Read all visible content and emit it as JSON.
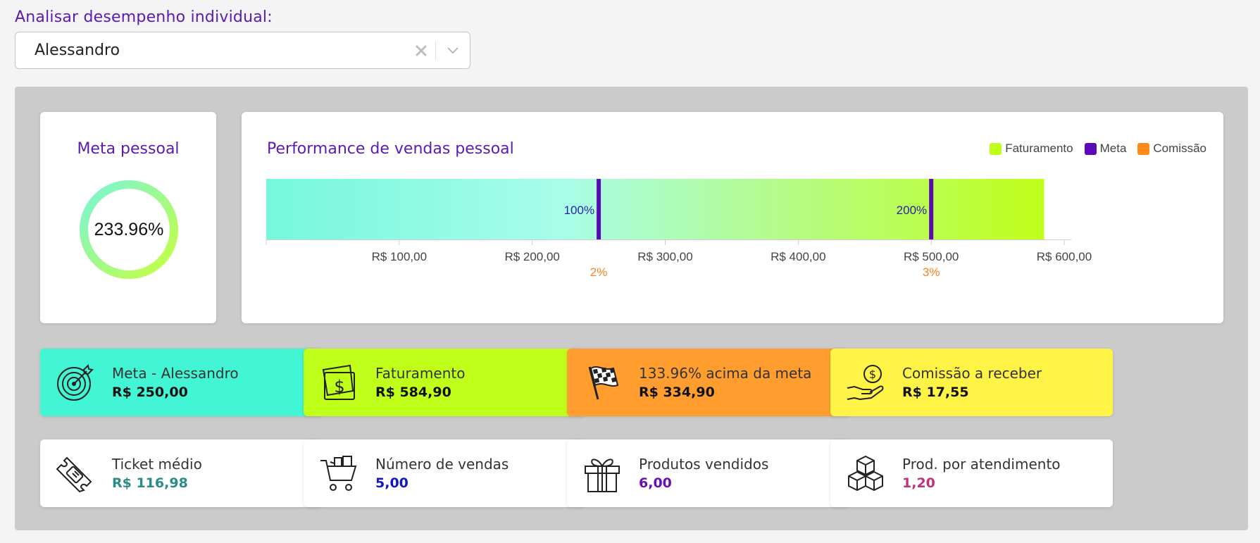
{
  "selector": {
    "label": "Analisar desempenho individual:",
    "value": "Alessandro"
  },
  "meta_card": {
    "title": "Meta pessoal",
    "percent_text": "233.96%",
    "progress_fraction": 1.0
  },
  "perf_card": {
    "title": "Performance de vendas pessoal"
  },
  "chart_data": {
    "type": "bar",
    "orientation": "horizontal",
    "title": "Performance de vendas pessoal",
    "series": [
      {
        "name": "Faturamento",
        "value": 584.9,
        "color": "#c0ff1a"
      }
    ],
    "meta_lines": [
      {
        "value": 250,
        "label": "100%"
      },
      {
        "value": 500,
        "label": "200%"
      }
    ],
    "commission_labels": [
      {
        "value": 250,
        "label": "2%"
      },
      {
        "value": 500,
        "label": "3%"
      }
    ],
    "legend": [
      {
        "name": "Faturamento",
        "color": "#c0ff1a"
      },
      {
        "name": "Meta",
        "color": "#5b0ab8"
      },
      {
        "name": "Comissão",
        "color": "#ff8a1a"
      }
    ],
    "xlim": [
      0,
      600
    ],
    "ticks": [
      {
        "value": 0,
        "label": ""
      },
      {
        "value": 100,
        "label": "R$ 100,00"
      },
      {
        "value": 200,
        "label": "R$ 200,00"
      },
      {
        "value": 300,
        "label": "R$ 300,00"
      },
      {
        "value": 400,
        "label": "R$ 400,00"
      },
      {
        "value": 500,
        "label": "R$ 500,00"
      },
      {
        "value": 600,
        "label": "R$ 600,00"
      }
    ],
    "legend_position": "top-right",
    "grid": false
  },
  "kpis_top": [
    {
      "label": "Meta - Alessandro",
      "value": "R$ 250,00",
      "bg": "#42f5d5",
      "icon": "target-icon"
    },
    {
      "label": "Faturamento",
      "value": "R$ 584,90",
      "bg": "#c0ff1a",
      "icon": "money-icon"
    },
    {
      "label": "133.96% acima da meta",
      "value": "R$ 334,90",
      "bg": "#ff9e2e",
      "icon": "checkered-flag-icon"
    },
    {
      "label": "Comissão a receber",
      "value": "R$ 17,55",
      "bg": "#fff346",
      "icon": "hand-coin-icon"
    }
  ],
  "kpis_bottom": [
    {
      "label": "Ticket médio",
      "value": "R$ 116,98",
      "value_color": "#2a8c85",
      "icon": "ticket-icon"
    },
    {
      "label": "Número de vendas",
      "value": "5,00",
      "value_color": "#1515c8",
      "icon": "shopping-cart-icon"
    },
    {
      "label": "Produtos vendidos",
      "value": "6,00",
      "value_color": "#6a0fb3",
      "icon": "gift-icon"
    },
    {
      "label": "Prod. por atendimento",
      "value": "1,20",
      "value_color": "#c0327a",
      "icon": "boxes-icon"
    }
  ]
}
